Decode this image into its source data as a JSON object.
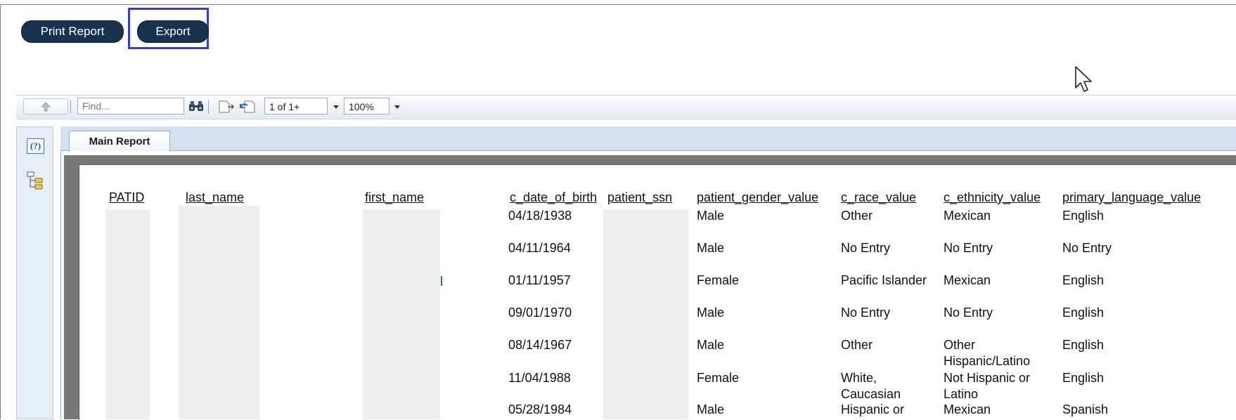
{
  "top_buttons": {
    "print_label": "Print Report",
    "export_label": "Export"
  },
  "toolbar": {
    "find_placeholder": "Find...",
    "page_value": "1 of 1+",
    "zoom_value": "100%"
  },
  "side_panel": {
    "help_label": "(?)"
  },
  "tabs": {
    "main_label": "Main Report"
  },
  "report": {
    "headers": {
      "patid": "PATID",
      "last_name": "last_name",
      "first_name": "first_name",
      "dob": "c_date_of_birth",
      "ssn": "patient_ssn",
      "gender": "patient_gender_value",
      "race": "c_race_value",
      "ethnicity": "c_ethnicity_value",
      "language": "primary_language_value"
    },
    "rows": [
      {
        "dob": "04/18/1938",
        "gender": "Male",
        "race": "Other",
        "race2": "",
        "ethnicity": "Mexican",
        "ethnicity2": "",
        "language": "English"
      },
      {
        "dob": "04/11/1964",
        "gender": "Male",
        "race": "No Entry",
        "race2": "",
        "ethnicity": "No Entry",
        "ethnicity2": "",
        "language": "No Entry"
      },
      {
        "dob": "01/11/1957",
        "gender": "Female",
        "race": "Pacific Islander",
        "race2": "",
        "ethnicity": "Mexican",
        "ethnicity2": "",
        "language": "English"
      },
      {
        "dob": "09/01/1970",
        "gender": "Male",
        "race": "No Entry",
        "race2": "",
        "ethnicity": "No Entry",
        "ethnicity2": "",
        "language": "English"
      },
      {
        "dob": "08/14/1967",
        "gender": "Male",
        "race": "Other",
        "race2": "",
        "ethnicity": "Other",
        "ethnicity2": "Hispanic/Latino",
        "language": "English"
      },
      {
        "dob": "11/04/1988",
        "gender": "Female",
        "race": "White,",
        "race2": "Caucasian",
        "ethnicity": "Not Hispanic or",
        "ethnicity2": "Latino",
        "language": "English"
      },
      {
        "dob": "05/28/1984",
        "gender": "Male",
        "race": "Hispanic or",
        "race2": "",
        "ethnicity": "Mexican",
        "ethnicity2": "",
        "language": "Spanish"
      }
    ]
  },
  "colors": {
    "button_bg": "#17324f",
    "highlight_border": "#3a3ad8",
    "toolbar_bg": "#e3ebf5",
    "report_bezel": "#777777"
  },
  "icons": [
    "up-arrow-icon",
    "binoculars-icon",
    "page-next-icon",
    "page-back-icon",
    "help-icon",
    "group-tree-icon",
    "mouse-cursor-icon"
  ]
}
